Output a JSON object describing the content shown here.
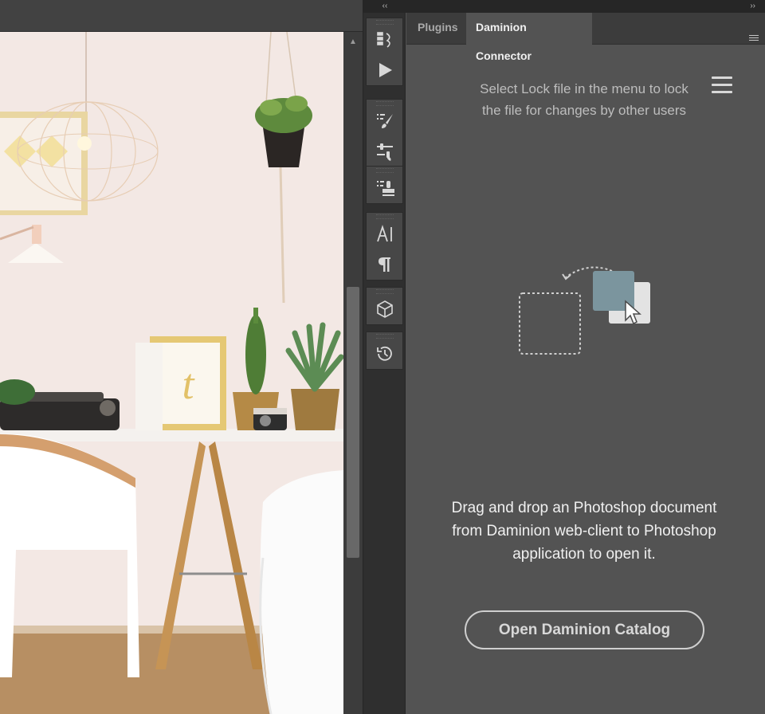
{
  "tool_strip": {
    "collapse_icon": "collapse-left-icon",
    "groups": [
      {
        "tools": [
          "actions-icon",
          "play-icon"
        ]
      },
      {
        "tools": [
          "brush-presets-icon",
          "adjustments-icon"
        ]
      },
      {
        "tools": [
          "clone-source-icon"
        ]
      },
      {
        "tools": [
          "character-icon",
          "paragraph-icon"
        ]
      },
      {
        "tools": [
          "3d-icon"
        ]
      },
      {
        "tools": [
          "history-icon"
        ]
      }
    ]
  },
  "panel": {
    "collapse_icon": "collapse-right-icon",
    "tabs": [
      {
        "label": "Plugins",
        "active": false
      },
      {
        "label": "Daminion Connector",
        "active": true
      }
    ],
    "lock_message": "Select Lock file in the menu to lock the file for changes by other users",
    "drag_message": "Drag and drop an Photoshop document from Daminion web-client to Photoshop application to open it.",
    "open_button_label": "Open Daminion Catalog",
    "colors": {
      "panel_bg": "#535353",
      "tile_accent": "#7b959e",
      "tile_secondary": "#e3e3e3"
    }
  }
}
